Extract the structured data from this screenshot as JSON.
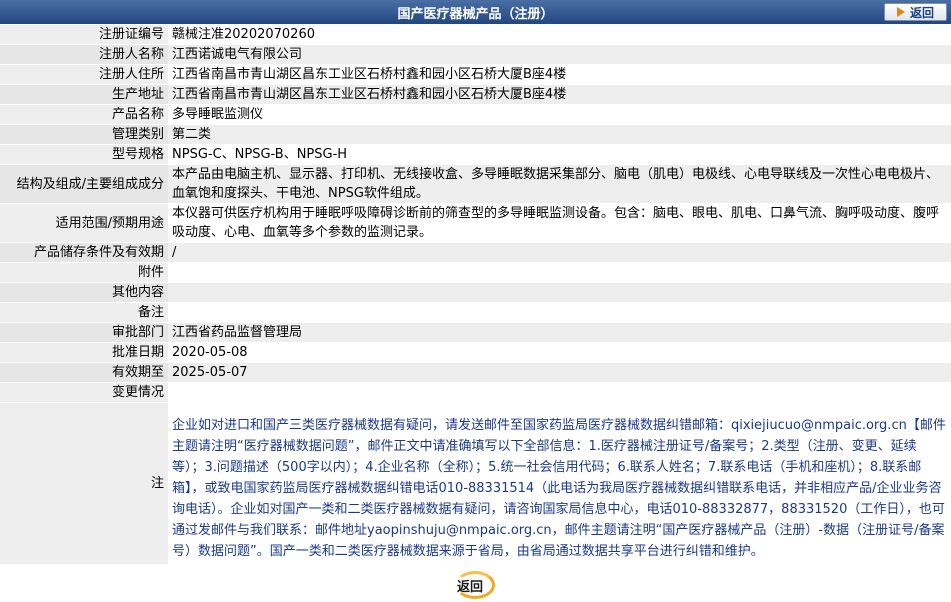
{
  "header": {
    "title": "国产医疗器械产品（注册）",
    "back_label": "返回"
  },
  "rows": [
    {
      "label": "注册证编号",
      "value": "赣械注准20202070260"
    },
    {
      "label": "注册人名称",
      "value": "江西诺诚电气有限公司"
    },
    {
      "label": "注册人住所",
      "value": "江西省南昌市青山湖区昌东工业区石桥村鑫和园小区石桥大厦B座4楼"
    },
    {
      "label": "生产地址",
      "value": "江西省南昌市青山湖区昌东工业区石桥村鑫和园小区石桥大厦B座4楼"
    },
    {
      "label": "产品名称",
      "value": "多导睡眠监测仪"
    },
    {
      "label": "管理类别",
      "value": "第二类"
    },
    {
      "label": "型号规格",
      "value": "NPSG-C、NPSG-B、NPSG-H"
    },
    {
      "label": "结构及组成/主要组成成分",
      "value": "本产品由电脑主机、显示器、打印机、无线接收盒、多导睡眠数据采集部分、脑电（肌电）电极线、心电导联线及一次性心电电极片、血氧饱和度探头、干电池、NPSG软件组成。"
    },
    {
      "label": "适用范围/预期用途",
      "value": "本仪器可供医疗机构用于睡眠呼吸障碍诊断前的筛查型的多导睡眠监测设备。包含：脑电、眼电、肌电、口鼻气流、胸呼吸动度、腹呼吸动度、心电、血氧等多个参数的监测记录。"
    },
    {
      "label": "产品储存条件及有效期",
      "value": "/"
    },
    {
      "label": "附件",
      "value": ""
    },
    {
      "label": "其他内容",
      "value": ""
    },
    {
      "label": "备注",
      "value": ""
    },
    {
      "label": "审批部门",
      "value": "江西省药品监督管理局"
    },
    {
      "label": "批准日期",
      "value": "2020-05-08"
    },
    {
      "label": "有效期至",
      "value": "2025-05-07"
    },
    {
      "label": "变更情况",
      "value": ""
    }
  ],
  "note": {
    "label": "注",
    "text": "企业如对进口和国产三类医疗器械数据有疑问，请发送邮件至国家药监局医疗器械数据纠错邮箱：qixiejiucuo@nmpaic.org.cn【邮件主题请注明“医疗器械数据问题”，邮件正文中请准确填写以下全部信息：1.医疗器械注册证号/备案号；2.类型（注册、变更、延续等）；3.问题描述（500字以内）；4.企业名称（全称）；5.统一社会信用代码；6.联系人姓名；7.联系电话（手机和座机）；8.联系邮箱】，或致电国家药监局医疗器械数据纠错电话010-88331514（此电话为我局医疗器械数据纠错联系电话，并非相应产品/企业业务咨询电话）。企业如对国产一类和二类医疗器械数据有疑问，请咨询国家局信息中心，电话010-88332877，88331520（工作日），也可通过发邮件与我们联系：邮件地址yaopinshuju@nmpaic.org.cn，邮件主题请注明“国产医疗器械产品（注册）-数据（注册证号/备案号）数据问题”。国产一类和二类医疗器械数据来源于省局，由省局通过数据共享平台进行纠错和维护。"
  },
  "footer": {
    "back_label": "返回"
  }
}
